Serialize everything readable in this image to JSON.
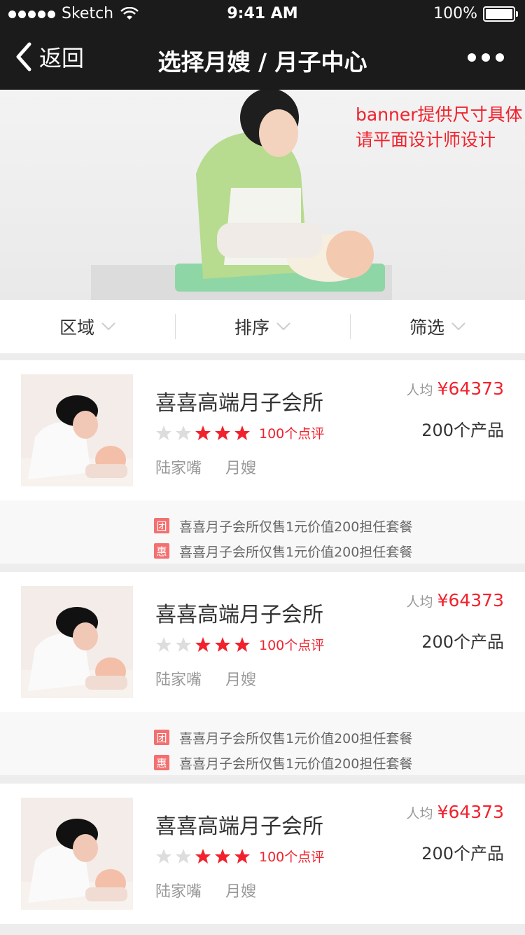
{
  "status_bar": {
    "carrier": "Sketch",
    "time": "9:41 AM",
    "battery": "100%"
  },
  "nav": {
    "back_label": "返回",
    "title": "选择月嫂 / 月子中心"
  },
  "banner": {
    "line1": "banner提供尺寸具体",
    "line2": "请平面设计师设计"
  },
  "filters": [
    {
      "label": "区域"
    },
    {
      "label": "排序"
    },
    {
      "label": "筛选"
    }
  ],
  "colors": {
    "accent": "#f1222d",
    "nav_bg": "#1b1b1b",
    "badge": "#f47070"
  },
  "listings": [
    {
      "name": "喜喜高端月子会所",
      "rating_stars": 3,
      "stars_total": 5,
      "reviews": "100个点评",
      "area": "陆家嘴",
      "type": "月嫂",
      "price_label": "人均",
      "price": "¥64373",
      "products": "200个产品",
      "promos": [
        {
          "badge": "团",
          "text": "喜喜月子会所仅售1元价值200担任套餐"
        },
        {
          "badge": "惠",
          "text": "喜喜月子会所仅售1元价值200担任套餐"
        }
      ]
    },
    {
      "name": "喜喜高端月子会所",
      "rating_stars": 3,
      "stars_total": 5,
      "reviews": "100个点评",
      "area": "陆家嘴",
      "type": "月嫂",
      "price_label": "人均",
      "price": "¥64373",
      "products": "200个产品",
      "promos": [
        {
          "badge": "团",
          "text": "喜喜月子会所仅售1元价值200担任套餐"
        },
        {
          "badge": "惠",
          "text": "喜喜月子会所仅售1元价值200担任套餐"
        }
      ]
    },
    {
      "name": "喜喜高端月子会所",
      "rating_stars": 3,
      "stars_total": 5,
      "reviews": "100个点评",
      "area": "陆家嘴",
      "type": "月嫂",
      "price_label": "人均",
      "price": "¥64373",
      "products": "200个产品",
      "promos": []
    }
  ]
}
